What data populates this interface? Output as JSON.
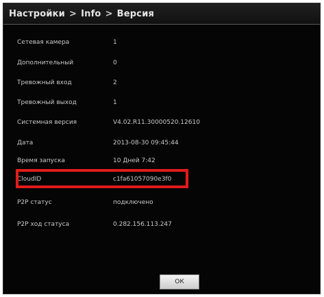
{
  "breadcrumb": [
    "Настройки",
    "Info",
    "Версия"
  ],
  "separator": ">",
  "rows": [
    {
      "label": "Сетевая камера",
      "value": "1"
    },
    {
      "label": "Дополнительный",
      "value": "0"
    },
    {
      "label": "Тревожный вход",
      "value": "2"
    },
    {
      "label": "Тревожный выход",
      "value": "1"
    },
    {
      "label": "Системная версия",
      "value": "V4.02.R11.30000520.12610"
    },
    {
      "label": "Дата",
      "value": "2013-08-30 09:45:44"
    },
    {
      "label": "Время запуска",
      "value": "10 Дней 7:42"
    },
    {
      "label": "CloudID",
      "value": "c1fa61057090e3f0"
    },
    {
      "label": "P2P статус",
      "value": "подключено"
    },
    {
      "label": "P2P ход статуса",
      "value": "0.282.156.113.247"
    }
  ],
  "ok_label": "ОК",
  "highlight_color": "#e11b1b"
}
